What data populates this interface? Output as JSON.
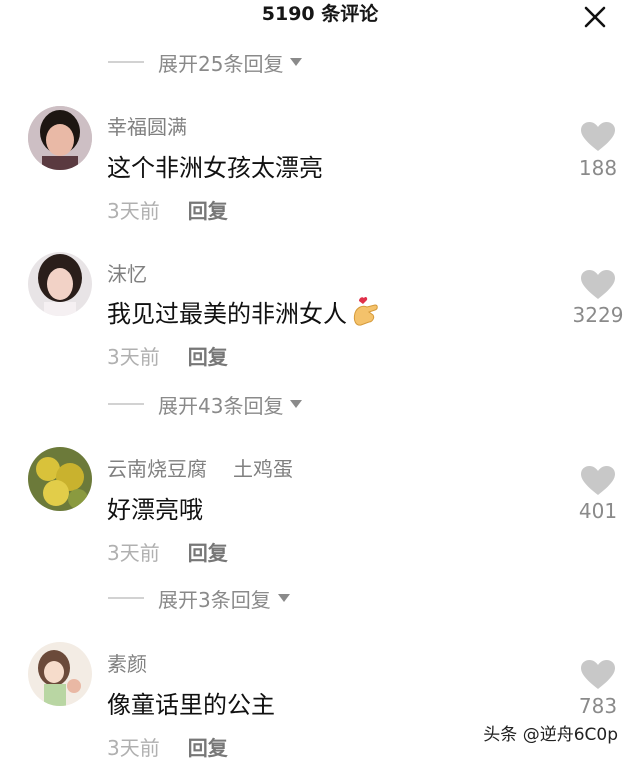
{
  "header": {
    "title": "5190 条评论"
  },
  "expand_rows": [
    "展开25条回复",
    "展开43条回复",
    "展开3条回复"
  ],
  "comments": [
    {
      "username": "幸福圆满",
      "tag": "",
      "text": "这个非洲女孩太漂亮",
      "emoji": "",
      "time": "3天前",
      "reply": "回复",
      "likes": "188"
    },
    {
      "username": "沫忆",
      "tag": "",
      "text": "我见过最美的非洲女人",
      "emoji": "🫰",
      "time": "3天前",
      "reply": "回复",
      "likes": "3229"
    },
    {
      "username": "云南烧豆腐",
      "tag": "土鸡蛋",
      "text": "好漂亮哦",
      "emoji": "",
      "time": "3天前",
      "reply": "回复",
      "likes": "401"
    },
    {
      "username": "素颜",
      "tag": "",
      "text": "像童话里的公主",
      "emoji": "",
      "time": "3天前",
      "reply": "回复",
      "likes": "783"
    }
  ],
  "watermark": "头条 @逆舟6C0p",
  "colors": {
    "like_icon": "#c8c8c8",
    "expand_text": "#8a8a8a"
  }
}
